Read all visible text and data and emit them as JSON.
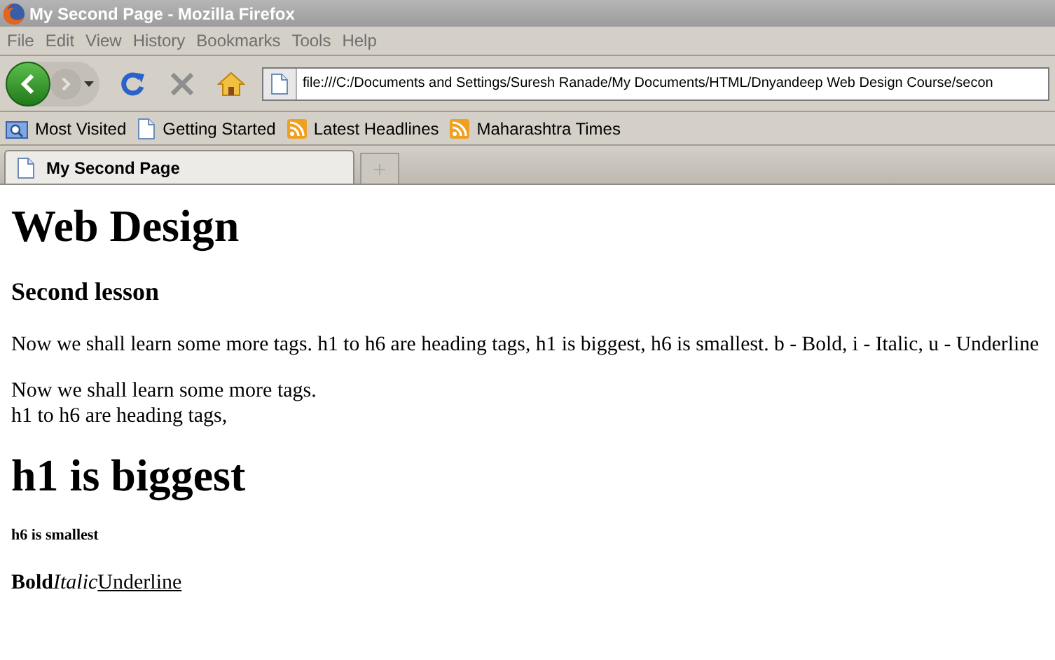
{
  "window": {
    "title": "My Second Page - Mozilla Firefox"
  },
  "menu": [
    "File",
    "Edit",
    "View",
    "History",
    "Bookmarks",
    "Tools",
    "Help"
  ],
  "address_bar": {
    "value": "file:///C:/Documents and Settings/Suresh Ranade/My Documents/HTML/Dnyandeep Web Design Course/secon"
  },
  "bookmarks": [
    {
      "label": "Most Visited",
      "kind": "folder"
    },
    {
      "label": "Getting Started",
      "kind": "page"
    },
    {
      "label": "Latest Headlines",
      "kind": "feed"
    },
    {
      "label": "Maharashtra Times",
      "kind": "feed"
    }
  ],
  "tabs": [
    {
      "label": "My Second Page",
      "selected": true
    }
  ],
  "content": [
    {
      "kind": "h1",
      "text": "Web Design"
    },
    {
      "kind": "h3",
      "text": "Second lesson"
    },
    {
      "kind": "p",
      "text": "Now we shall learn some more tags. h1 to h6 are heading tags, h1 is biggest, h6 is smallest. b - Bold, i - Italic, u - Underline"
    },
    {
      "kind": "lines",
      "lines": [
        "Now we shall learn some more tags.",
        "h1 to h6 are heading tags,"
      ]
    },
    {
      "kind": "h1",
      "text": "h1 is biggest"
    },
    {
      "kind": "h6",
      "text": "h6 is smallest"
    },
    {
      "kind": "formats",
      "parts": [
        {
          "kind": "bold",
          "text": "Bold"
        },
        {
          "kind": "italic",
          "text": "Italic"
        },
        {
          "kind": "underline",
          "text": "Underline"
        }
      ]
    }
  ]
}
